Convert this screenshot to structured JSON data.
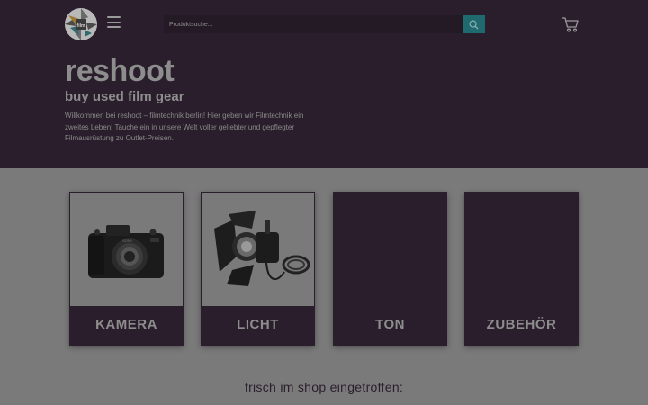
{
  "header": {
    "search": {
      "placeholder": "Produktsuche...",
      "value": ""
    },
    "icons": {
      "logo": "reshoot-aperture-logo",
      "menu": "hamburger-icon",
      "search": "search-icon",
      "cart": "cart-icon"
    }
  },
  "hero": {
    "title": "reshoot",
    "subtitle": "buy used film gear",
    "description": "Willkommen bei reshoot – filmtechnik berlin! Hier geben wir Filmtechnik ein zweites Leben! Tauche ein in unsere Welt voller geliebter und gepflegter Filmausrüstung zu Outlet-Preisen."
  },
  "categories": [
    {
      "label": "KAMERA",
      "image": "camera"
    },
    {
      "label": "LICHT",
      "image": "film-light"
    },
    {
      "label": "TON",
      "image": ""
    },
    {
      "label": "ZUBEHÖR",
      "image": ""
    }
  ],
  "section": {
    "fresh_heading": "frisch im shop eingetroffen:"
  },
  "colors": {
    "hero_bg": "#2a1e2c",
    "page_bg": "#7a7a7a",
    "accent": "#1f6a6e",
    "text_muted": "#8d8d8d"
  }
}
